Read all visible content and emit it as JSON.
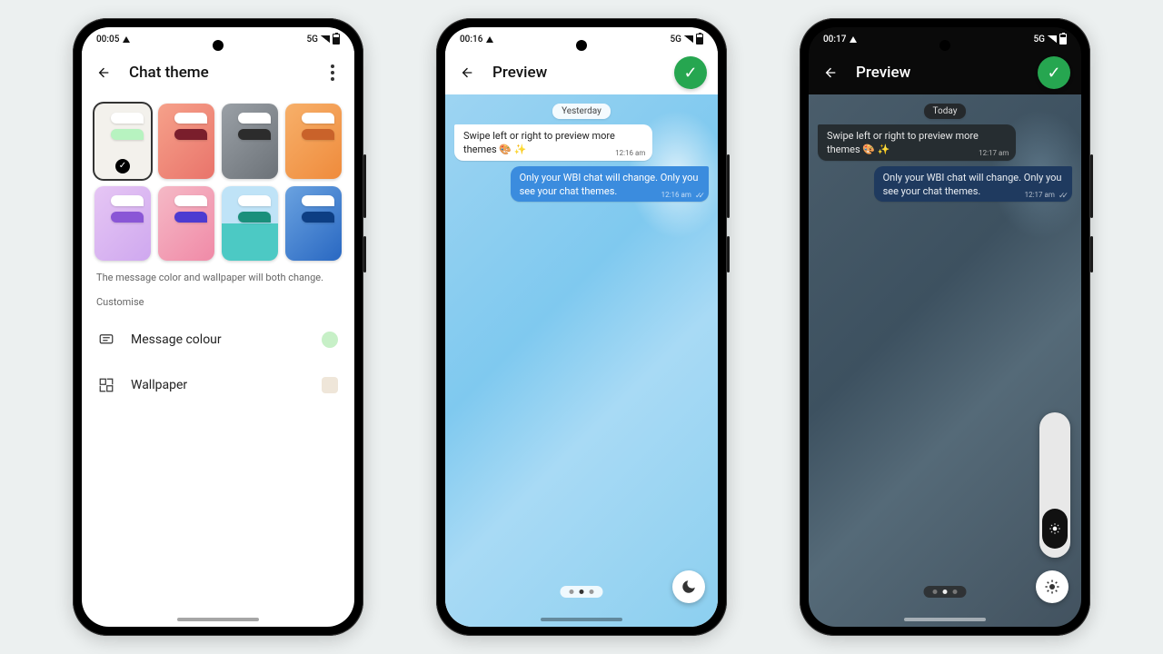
{
  "phone1": {
    "status": {
      "time": "00:05",
      "net": "5G"
    },
    "title": "Chat theme",
    "hint": "The message color and wallpaper will both change.",
    "customiseLabel": "Customise",
    "rows": {
      "messageColour": "Message colour",
      "wallpaper": "Wallpaper"
    },
    "themes": [
      {
        "bg": "#f3f1ec",
        "bubble": "#b7f3c0",
        "selected": true
      },
      {
        "bg": "linear-gradient(135deg,#f6a18a,#e9746b)",
        "bubble": "#7a1e2c"
      },
      {
        "bg": "linear-gradient(135deg,#9aa0a6,#6c7278)",
        "bubble": "#2c2c2c"
      },
      {
        "bg": "linear-gradient(135deg,#f7b06a,#ef8b3c)",
        "bubble": "#c9622a"
      },
      {
        "bg": "linear-gradient(135deg,#e6c6f4,#cfa8ef)",
        "bubble": "#8a56d6"
      },
      {
        "bg": "linear-gradient(135deg,#f5b9c6,#f08aa7)",
        "bubble": "#4d3bd1"
      },
      {
        "bg": "linear-gradient(180deg,#bfe3f7 50%,#4cc9c4 50%)",
        "bubble": "#1a8f7b"
      },
      {
        "bg": "linear-gradient(135deg,#6aa2e0,#2968c2)",
        "bubble": "#0d3e83"
      }
    ],
    "messageColourSwatch": "#c7f0c7",
    "wallpaperSwatch": "#efe6d9"
  },
  "phone2": {
    "status": {
      "time": "00:16",
      "net": "5G"
    },
    "title": "Preview",
    "dateLabel": "Yesterday",
    "mode": "light",
    "incoming": {
      "text": "Swipe left or right to preview more themes 🎨 ✨",
      "time": "12:16 am"
    },
    "outgoing": {
      "text": "Only your WBI chat will change. Only you see your chat themes.",
      "time": "12:16 am"
    }
  },
  "phone3": {
    "status": {
      "time": "00:17",
      "net": "5G"
    },
    "title": "Preview",
    "dateLabel": "Today",
    "mode": "dark",
    "incoming": {
      "text": "Swipe left or right to preview more themes 🎨 ✨",
      "time": "12:17 am"
    },
    "outgoing": {
      "text": "Only your WBI chat will change. Only you see your chat themes.",
      "time": "12:17 am"
    }
  }
}
